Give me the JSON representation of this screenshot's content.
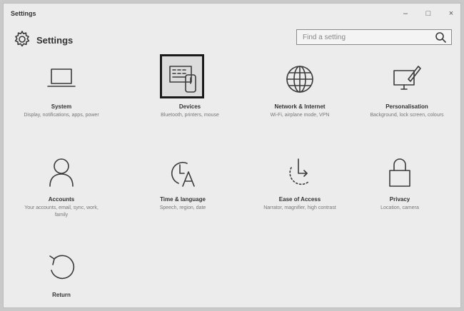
{
  "window": {
    "title": "Settings",
    "controls": {
      "minimize": "–",
      "maximize": "□",
      "close": "×"
    }
  },
  "header": {
    "title": "Settings",
    "search_placeholder": "Find a setting"
  },
  "tiles": [
    {
      "label": "System",
      "desc": "Display, notifications, apps, power",
      "icon": "laptop-icon"
    },
    {
      "label": "Devices",
      "desc": "Bluetooth, printers, mouse",
      "icon": "devices-icon"
    },
    {
      "label": "Network & Internet",
      "desc": "Wi-Fi, airplane mode, VPN",
      "icon": "globe-icon"
    },
    {
      "label": "Personalisation",
      "desc": "Background, lock screen, colours",
      "icon": "personalisation-icon"
    },
    {
      "label": "Accounts",
      "desc": "Your accounts, email, sync, work, family",
      "icon": "person-icon"
    },
    {
      "label": "Time & language",
      "desc": "Speech, region, date",
      "icon": "time-language-icon"
    },
    {
      "label": "Ease of Access",
      "desc": "Narrator, magnifier, high contrast",
      "icon": "ease-of-access-icon"
    },
    {
      "label": "Privacy",
      "desc": "Location, camera",
      "icon": "lock-icon"
    },
    {
      "label": "Return",
      "desc": "",
      "icon": "return-icon"
    }
  ]
}
